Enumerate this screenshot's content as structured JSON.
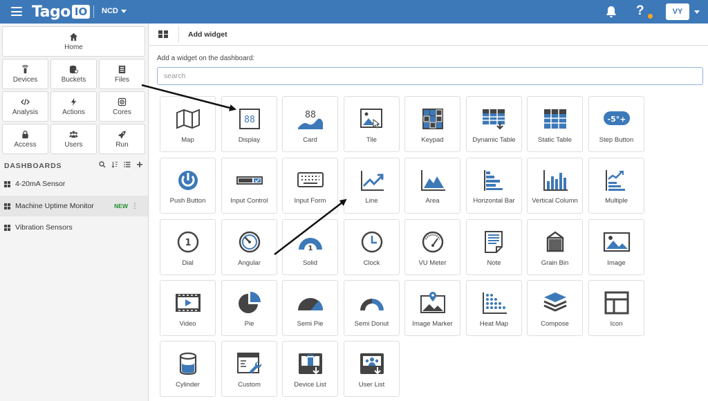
{
  "topbar": {
    "logo_text": "Tago",
    "logo_box": "IO",
    "org_label": "NCD",
    "help_label": "?",
    "avatar_initials": "VY",
    "icons": [
      "menu-icon",
      "bell-icon",
      "help-icon",
      "chevron-down-icon"
    ],
    "colors": {
      "bar": "#3d79b8",
      "badge": "#f5a623"
    }
  },
  "sidebar": {
    "home_label": "Home",
    "nav": [
      {
        "label": "Devices",
        "icon": "device-icon"
      },
      {
        "label": "Buckets",
        "icon": "bucket-icon"
      },
      {
        "label": "Files",
        "icon": "files-icon"
      },
      {
        "label": "Analysis",
        "icon": "code-icon"
      },
      {
        "label": "Actions",
        "icon": "bolt-icon"
      },
      {
        "label": "Cores",
        "icon": "cores-icon"
      },
      {
        "label": "Access",
        "icon": "lock-icon"
      },
      {
        "label": "Users",
        "icon": "users-icon"
      },
      {
        "label": "Run",
        "icon": "rocket-icon"
      }
    ],
    "dashboards_title": "DASHBOARDS",
    "dashboards": [
      {
        "name": "4-20mA Sensor"
      },
      {
        "name": "Machine Uptime Monitor",
        "badge": "NEW"
      },
      {
        "name": "Vibration Sensors"
      }
    ]
  },
  "main": {
    "header_title": "Add widget",
    "add_label": "Add a widget on the dashboard:",
    "search_placeholder": "search",
    "widgets": [
      "Map",
      "Display",
      "Card",
      "Tile",
      "Keypad",
      "Dynamic Table",
      "Static Table",
      "Step Button",
      "Push Button",
      "Input Control",
      "Input Form",
      "Line",
      "Area",
      "Horizontal Bar",
      "Vertical Column",
      "Multiple",
      "Dial",
      "Angular",
      "Solid",
      "Clock",
      "VU Meter",
      "Note",
      "Grain Bin",
      "Image",
      "Video",
      "Pie",
      "Semi Pie",
      "Semi Donut",
      "Image Marker",
      "Heat Map",
      "Compose",
      "Icon",
      "Cylinder",
      "Custom",
      "Device List",
      "User List"
    ],
    "icon_texts": {
      "display": "88",
      "card": "88",
      "step": "-5°+",
      "dial": "1",
      "solid": "1"
    },
    "colors": {
      "accent": "#3d79b8",
      "dark": "#444444"
    }
  }
}
